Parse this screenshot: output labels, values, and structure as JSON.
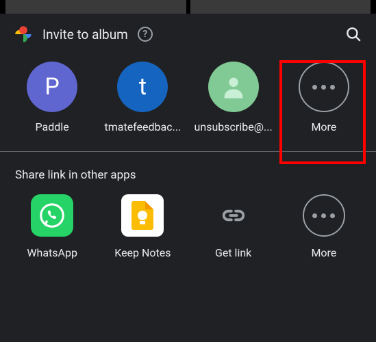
{
  "header": {
    "title": "Invite to album"
  },
  "contacts": [
    {
      "label": "Paddle",
      "letter": "P"
    },
    {
      "label": "tmatefeedbac...",
      "letter": "t"
    },
    {
      "label": "unsubscribe@..."
    },
    {
      "label": "More"
    }
  ],
  "section": {
    "other_apps_title": "Share link in other apps"
  },
  "apps": [
    {
      "label": "WhatsApp"
    },
    {
      "label": "Keep Notes"
    },
    {
      "label": "Get link"
    },
    {
      "label": "More"
    }
  ]
}
